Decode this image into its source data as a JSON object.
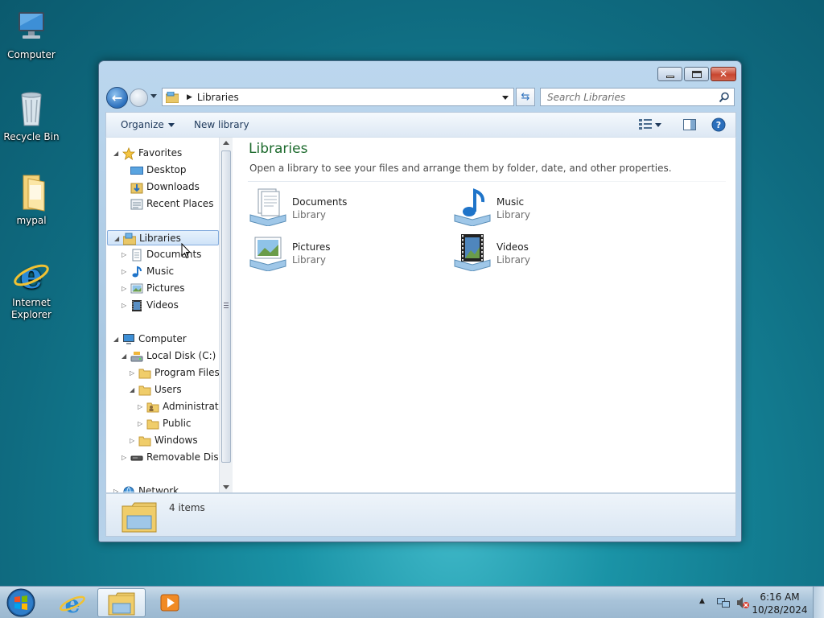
{
  "desktop": {
    "icons": [
      {
        "label": "Computer"
      },
      {
        "label": "Recycle Bin"
      },
      {
        "label": "mypal"
      },
      {
        "label": "Internet Explorer"
      }
    ]
  },
  "window": {
    "address": {
      "crumb": "Libraries"
    },
    "search": {
      "placeholder": "Search Libraries"
    },
    "toolbar": {
      "organize": "Organize",
      "new_library": "New library"
    },
    "nav_tree": {
      "favorites": "Favorites",
      "desktop": "Desktop",
      "downloads": "Downloads",
      "recent_places": "Recent Places",
      "libraries": "Libraries",
      "documents": "Documents",
      "music": "Music",
      "pictures": "Pictures",
      "videos": "Videos",
      "computer": "Computer",
      "local_disk": "Local Disk (C:)",
      "program_files": "Program Files",
      "users": "Users",
      "administrator": "Administrator",
      "public": "Public",
      "windows": "Windows",
      "removable_disk": "Removable Disk (",
      "network": "Network"
    },
    "content": {
      "title": "Libraries",
      "subtitle": "Open a library to see your files and arrange them by folder, date, and other properties.",
      "libraries": [
        {
          "name": "Documents",
          "type": "Library"
        },
        {
          "name": "Music",
          "type": "Library"
        },
        {
          "name": "Pictures",
          "type": "Library"
        },
        {
          "name": "Videos",
          "type": "Library"
        }
      ]
    },
    "details": {
      "count": "4 items"
    }
  },
  "taskbar": {
    "clock_time": "6:16 AM",
    "clock_date": "10/28/2024"
  },
  "colors": {
    "accent_title": "#1e6b2e",
    "selection": "#cfe3f8"
  }
}
